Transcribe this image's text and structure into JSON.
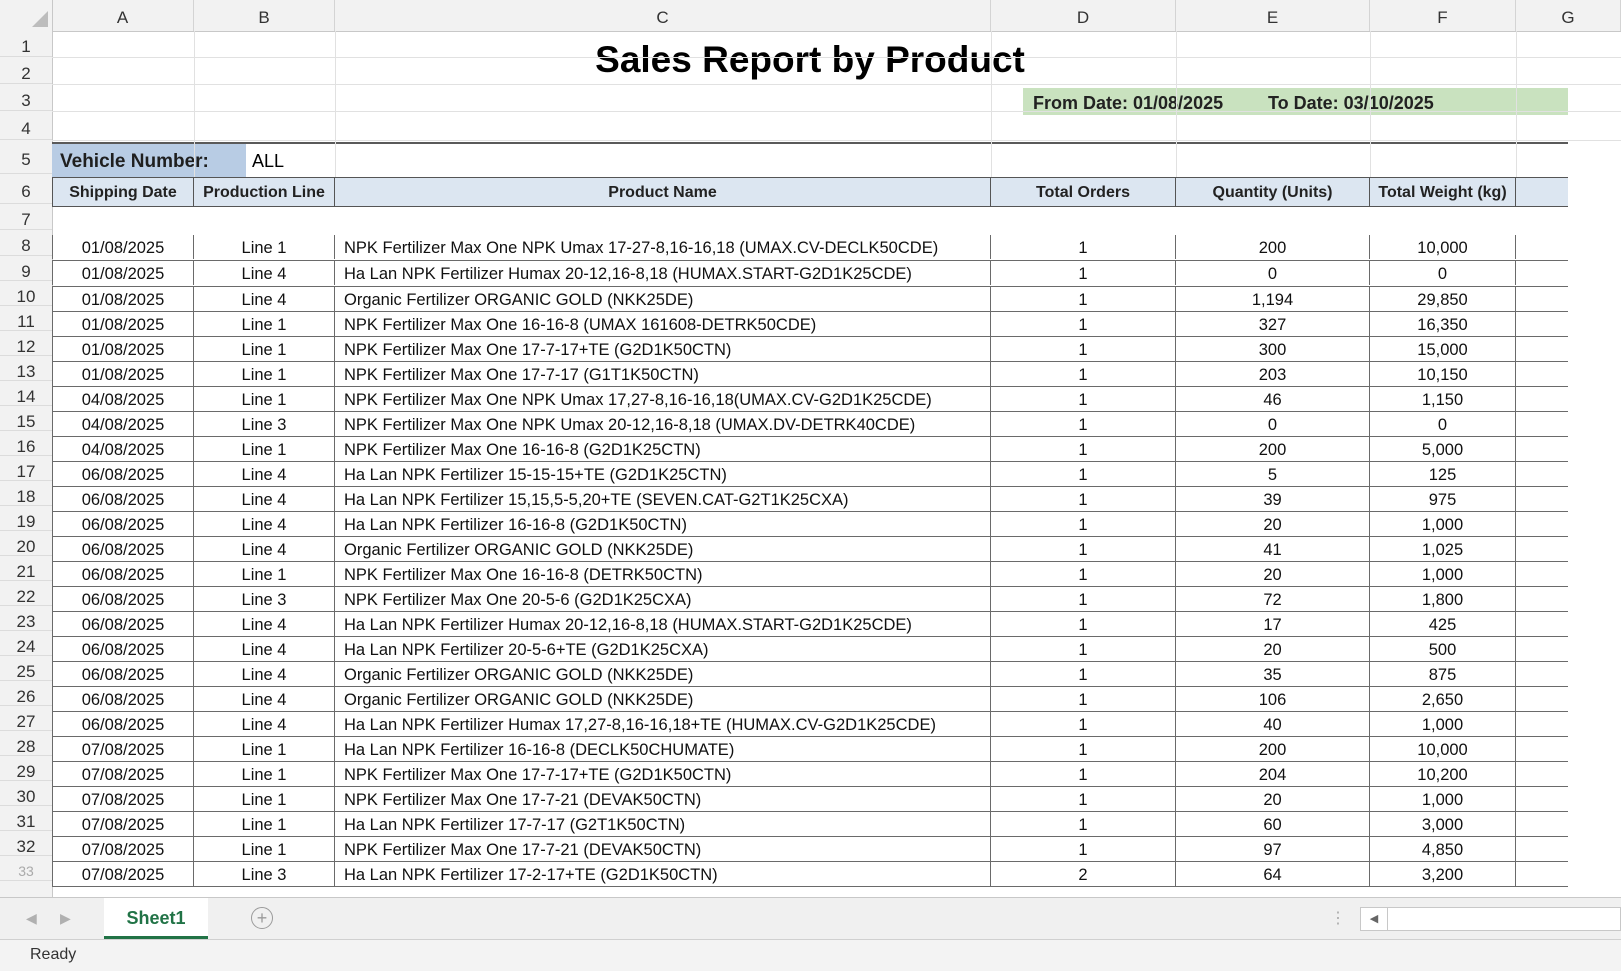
{
  "columns": [
    "A",
    "B",
    "C",
    "D",
    "E",
    "F",
    "G"
  ],
  "rows": [
    "1",
    "2",
    "3",
    "4",
    "5",
    "6",
    "7",
    "8",
    "9",
    "10",
    "11",
    "12",
    "13",
    "14",
    "15",
    "16",
    "17",
    "18",
    "19",
    "20",
    "21",
    "22",
    "23",
    "24",
    "25",
    "26",
    "27",
    "28",
    "29",
    "30",
    "31",
    "32",
    "33"
  ],
  "report": {
    "title": "Sales Report by Product",
    "from_date": "From Date: 01/08/2025",
    "to_date": "To Date: 03/10/2025",
    "vehicle_label": "Vehicle Number:",
    "vehicle_value": "ALL"
  },
  "table": {
    "headers": [
      "Shipping Date",
      "Production Line",
      "Product Name",
      "Total Orders",
      "Quantity (Units)",
      "Total Weight (kg)"
    ],
    "rows": [
      [
        "01/08/2025",
        "Line 1",
        "NPK Fertilizer Max One NPK Umax 17-27-8,16-16,18 (UMAX.CV-DECLK50CDE)",
        "1",
        "200",
        "10,000"
      ],
      [
        "01/08/2025",
        "Line 4",
        "Ha Lan NPK Fertilizer Humax 20-12,16-8,18  (HUMAX.START-G2D1K25CDE)",
        "1",
        "0",
        "0"
      ],
      [
        "01/08/2025",
        "Line 4",
        "Organic Fertilizer ORGANIC GOLD (NKK25DE)",
        "1",
        "1,194",
        "29,850"
      ],
      [
        "01/08/2025",
        "Line 1",
        "NPK Fertilizer Max One 16-16-8 (UMAX 161608-DETRK50CDE)",
        "1",
        "327",
        "16,350"
      ],
      [
        "01/08/2025",
        "Line 1",
        "NPK Fertilizer Max One 17-7-17+TE (G2D1K50CTN)",
        "1",
        "300",
        "15,000"
      ],
      [
        "01/08/2025",
        "Line 1",
        "NPK Fertilizer Max One 17-7-17  (G1T1K50CTN)",
        "1",
        "203",
        "10,150"
      ],
      [
        "04/08/2025",
        "Line 1",
        "NPK Fertilizer Max One NPK Umax 17,27-8,16-16,18(UMAX.CV-G2D1K25CDE)",
        "1",
        "46",
        "1,150"
      ],
      [
        "04/08/2025",
        "Line 3",
        "NPK Fertilizer Max One NPK Umax 20-12,16-8,18 (UMAX.DV-DETRK40CDE)",
        "1",
        "0",
        "0"
      ],
      [
        "04/08/2025",
        "Line 1",
        "NPK Fertilizer Max One 16-16-8 (G2D1K25CTN)",
        "1",
        "200",
        "5,000"
      ],
      [
        "06/08/2025",
        "Line 4",
        "Ha Lan NPK Fertilizer 15-15-15+TE (G2D1K25CTN)",
        "1",
        "5",
        "125"
      ],
      [
        "06/08/2025",
        "Line 4",
        "Ha Lan NPK Fertilizer 15,15,5-5,20+TE  (SEVEN.CAT-G2T1K25CXA)",
        "1",
        "39",
        "975"
      ],
      [
        "06/08/2025",
        "Line 4",
        "Ha Lan NPK Fertilizer 16-16-8 (G2D1K50CTN)",
        "1",
        "20",
        "1,000"
      ],
      [
        "06/08/2025",
        "Line 4",
        "Organic Fertilizer ORGANIC GOLD (NKK25DE)",
        "1",
        "41",
        "1,025"
      ],
      [
        "06/08/2025",
        "Line 1",
        "NPK Fertilizer Max One 16-16-8 (DETRK50CTN)",
        "1",
        "20",
        "1,000"
      ],
      [
        "06/08/2025",
        "Line 3",
        "NPK Fertilizer Max One 20-5-6 (G2D1K25CXA)",
        "1",
        "72",
        "1,800"
      ],
      [
        "06/08/2025",
        "Line 4",
        "Ha Lan NPK Fertilizer Humax 20-12,16-8,18  (HUMAX.START-G2D1K25CDE)",
        "1",
        "17",
        "425"
      ],
      [
        "06/08/2025",
        "Line 4",
        "Ha Lan NPK Fertilizer 20-5-6+TE (G2D1K25CXA)",
        "1",
        "20",
        "500"
      ],
      [
        "06/08/2025",
        "Line 4",
        "Organic Fertilizer ORGANIC GOLD (NKK25DE)",
        "1",
        "35",
        "875"
      ],
      [
        "06/08/2025",
        "Line 4",
        "Organic Fertilizer ORGANIC GOLD (NKK25DE)",
        "1",
        "106",
        "2,650"
      ],
      [
        "06/08/2025",
        "Line 4",
        "Ha Lan NPK Fertilizer Humax 17,27-8,16-16,18+TE  (HUMAX.CV-G2D1K25CDE)",
        "1",
        "40",
        "1,000"
      ],
      [
        "07/08/2025",
        "Line 1",
        "Ha Lan NPK Fertilizer 16-16-8 (DECLK50CHUMATE)",
        "1",
        "200",
        "10,000"
      ],
      [
        "07/08/2025",
        "Line 1",
        "NPK Fertilizer Max One 17-7-17+TE (G2D1K50CTN)",
        "1",
        "204",
        "10,200"
      ],
      [
        "07/08/2025",
        "Line 1",
        "NPK Fertilizer Max One 17-7-21 (DEVAK50CTN)",
        "1",
        "20",
        "1,000"
      ],
      [
        "07/08/2025",
        "Line 1",
        "Ha Lan NPK Fertilizer 17-7-17  (G2T1K50CTN)",
        "1",
        "60",
        "3,000"
      ],
      [
        "07/08/2025",
        "Line 1",
        "NPK Fertilizer Max One 17-7-21 (DEVAK50CTN)",
        "1",
        "97",
        "4,850"
      ],
      [
        "07/08/2025",
        "Line 3",
        "Ha Lan NPK Fertilizer 17-2-17+TE (G2D1K50CTN)",
        "2",
        "64",
        "3,200"
      ]
    ]
  },
  "sheet_tabs": {
    "active": "Sheet1",
    "add_label": "+"
  },
  "status": {
    "text": "Ready"
  },
  "icons": {
    "prev": "chevron-left-icon",
    "next": "chevron-right-icon",
    "add": "plus-circle-icon"
  },
  "colors": {
    "header_fill": "#dce6f1",
    "date_fill": "#c9e2bf",
    "vehicle_fill": "#b8cce4",
    "tab_accent": "#217346"
  }
}
